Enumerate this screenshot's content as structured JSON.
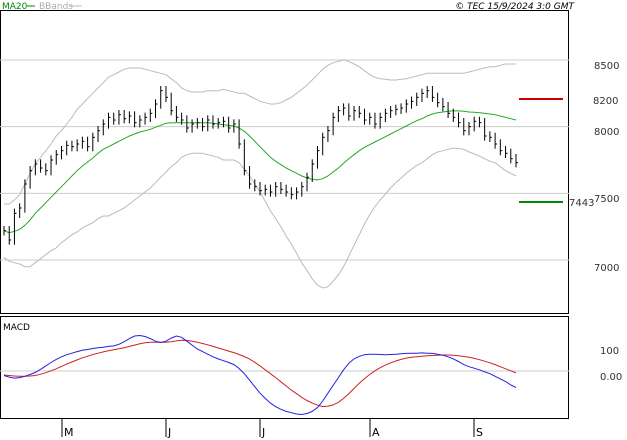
{
  "header": {
    "legend_ma20": "MA20",
    "legend_bbands": "BBands",
    "copyright": "© TEC 15/9/2024 3:0 GMT"
  },
  "price_panel": {
    "y_ticks": [
      "8500",
      "8000",
      "7500",
      "7000"
    ],
    "resistance": {
      "label": "8200",
      "value": 8200,
      "color": "#cc0000"
    },
    "support": {
      "label": "7443",
      "value": 7443,
      "color": "#008800"
    }
  },
  "macd_panel": {
    "title": "MACD",
    "y_ticks": [
      "100",
      "0.00"
    ]
  },
  "x_axis": {
    "months": [
      {
        "label": "M",
        "index": 10
      },
      {
        "label": "J",
        "index": 30
      },
      {
        "label": "J",
        "index": 50
      },
      {
        "label": "A",
        "index": 72
      },
      {
        "label": "S",
        "index": 94
      }
    ]
  },
  "colors": {
    "ma20": "#22aa22",
    "bbands": "#bbbbbb",
    "macd_line": "#2222dd",
    "macd_signal": "#cc2222",
    "candles": "#000000",
    "grid": "#cccccc"
  },
  "chart_data": {
    "type": "line",
    "ylim": [
      6700,
      8900
    ],
    "close": [
      7250,
      7180,
      7380,
      7420,
      7600,
      7700,
      7750,
      7720,
      7700,
      7780,
      7820,
      7850,
      7890,
      7880,
      7900,
      7920,
      7880,
      7950,
      8000,
      8050,
      8100,
      8080,
      8120,
      8090,
      8110,
      8060,
      8080,
      8100,
      8130,
      8200,
      8300,
      8250,
      8150,
      8100,
      8080,
      8020,
      8050,
      8060,
      8030,
      8080,
      8050,
      8060,
      8070,
      8020,
      8050,
      7900,
      7700,
      7600,
      7580,
      7550,
      7560,
      7540,
      7580,
      7560,
      7540,
      7520,
      7540,
      7580,
      7650,
      7750,
      7850,
      7950,
      8000,
      8100,
      8150,
      8170,
      8110,
      8150,
      8130,
      8080,
      8100,
      8050,
      8100,
      8130,
      8150,
      8160,
      8170,
      8200,
      8220,
      8250,
      8280,
      8300,
      8250,
      8210,
      8180,
      8130,
      8100,
      8060,
      8000,
      8030,
      8070,
      8060,
      7960,
      7950,
      7900,
      7850,
      7830,
      7790,
      7760
    ],
    "series": [
      {
        "name": "MA20",
        "values": [
          7250,
          7235,
          7245,
          7260,
          7290,
          7330,
          7380,
          7420,
          7460,
          7500,
          7540,
          7580,
          7620,
          7660,
          7700,
          7735,
          7765,
          7795,
          7830,
          7860,
          7880,
          7900,
          7920,
          7940,
          7960,
          7975,
          7990,
          8000,
          8010,
          8025,
          8040,
          8055,
          8060,
          8060,
          8060,
          8060,
          8060,
          8060,
          8060,
          8060,
          8055,
          8050,
          8045,
          8040,
          8035,
          8020,
          7995,
          7960,
          7920,
          7880,
          7840,
          7800,
          7770,
          7745,
          7720,
          7700,
          7680,
          7660,
          7645,
          7635,
          7630,
          7640,
          7660,
          7690,
          7720,
          7755,
          7790,
          7820,
          7850,
          7875,
          7895,
          7915,
          7935,
          7955,
          7975,
          7995,
          8015,
          8035,
          8055,
          8075,
          8090,
          8110,
          8125,
          8135,
          8140,
          8145,
          8150,
          8148,
          8145,
          8140,
          8138,
          8135,
          8130,
          8125,
          8120,
          8110,
          8100,
          8090,
          8080
        ]
      },
      {
        "name": "BBands",
        "values": []
      }
    ],
    "bb_upper": [
      7450,
      7450,
      7480,
      7520,
      7600,
      7680,
      7750,
      7800,
      7850,
      7900,
      7960,
      8000,
      8050,
      8100,
      8160,
      8200,
      8240,
      8280,
      8320,
      8360,
      8400,
      8420,
      8440,
      8460,
      8470,
      8470,
      8470,
      8460,
      8450,
      8440,
      8430,
      8420,
      8390,
      8360,
      8320,
      8300,
      8290,
      8290,
      8290,
      8300,
      8300,
      8300,
      8310,
      8300,
      8290,
      8280,
      8280,
      8260,
      8240,
      8220,
      8210,
      8200,
      8200,
      8210,
      8230,
      8250,
      8280,
      8310,
      8340,
      8380,
      8420,
      8460,
      8490,
      8510,
      8520,
      8530,
      8520,
      8500,
      8480,
      8450,
      8420,
      8400,
      8390,
      8385,
      8380,
      8380,
      8385,
      8390,
      8400,
      8410,
      8420,
      8430,
      8430,
      8430,
      8430,
      8430,
      8430,
      8430,
      8430,
      8440,
      8450,
      8460,
      8470,
      8480,
      8480,
      8490,
      8500,
      8500,
      8500
    ],
    "bb_lower": [
      7050,
      7020,
      7010,
      7000,
      6980,
      6980,
      7010,
      7040,
      7070,
      7100,
      7120,
      7160,
      7190,
      7220,
      7240,
      7270,
      7290,
      7310,
      7340,
      7360,
      7360,
      7380,
      7400,
      7420,
      7450,
      7480,
      7510,
      7540,
      7570,
      7610,
      7650,
      7690,
      7730,
      7760,
      7800,
      7820,
      7830,
      7830,
      7830,
      7820,
      7810,
      7800,
      7780,
      7780,
      7780,
      7760,
      7710,
      7660,
      7600,
      7540,
      7470,
      7400,
      7340,
      7280,
      7210,
      7150,
      7080,
      7010,
      6950,
      6890,
      6840,
      6820,
      6830,
      6870,
      6920,
      6980,
      7060,
      7140,
      7220,
      7300,
      7370,
      7430,
      7480,
      7525,
      7570,
      7610,
      7645,
      7680,
      7710,
      7740,
      7760,
      7790,
      7820,
      7840,
      7850,
      7860,
      7870,
      7866,
      7860,
      7840,
      7826,
      7810,
      7790,
      7770,
      7760,
      7730,
      7700,
      7680,
      7660
    ],
    "macd_line": [
      -2,
      -8,
      -12,
      -10,
      -5,
      2,
      10,
      22,
      35,
      48,
      60,
      70,
      78,
      84,
      90,
      95,
      98,
      102,
      105,
      107,
      110,
      112,
      118,
      128,
      140,
      150,
      152,
      148,
      140,
      130,
      125,
      130,
      142,
      150,
      145,
      130,
      115,
      100,
      90,
      80,
      70,
      62,
      55,
      48,
      40,
      25,
      5,
      -20,
      -45,
      -70,
      -90,
      -108,
      -122,
      -132,
      -140,
      -145,
      -150,
      -152,
      -148,
      -140,
      -125,
      -100,
      -70,
      -40,
      -10,
      20,
      45,
      62,
      72,
      78,
      80,
      80,
      79,
      78,
      79,
      80,
      82,
      83,
      84,
      84,
      85,
      84,
      83,
      80,
      76,
      70,
      62,
      52,
      40,
      32,
      26,
      20,
      12,
      5,
      -5,
      -15,
      -25,
      -38,
      -48
    ],
    "macd_signal": [
      0,
      -2,
      -4,
      -5,
      -5,
      -4,
      -2,
      3,
      9,
      16,
      24,
      33,
      42,
      50,
      58,
      66,
      72,
      79,
      84,
      89,
      93,
      97,
      101,
      105,
      110,
      115,
      120,
      124,
      126,
      126,
      126,
      126,
      128,
      131,
      134,
      133,
      130,
      126,
      121,
      116,
      110,
      104,
      98,
      92,
      86,
      79,
      71,
      61,
      49,
      35,
      20,
      5,
      -10,
      -26,
      -42,
      -58,
      -72,
      -86,
      -98,
      -108,
      -116,
      -121,
      -120,
      -115,
      -105,
      -90,
      -72,
      -52,
      -32,
      -14,
      2,
      16,
      28,
      38,
      47,
      54,
      60,
      65,
      68,
      70,
      72,
      74,
      75,
      76,
      77,
      77,
      76,
      74,
      71,
      68,
      64,
      59,
      53,
      47,
      40,
      32,
      24,
      16,
      8
    ]
  }
}
